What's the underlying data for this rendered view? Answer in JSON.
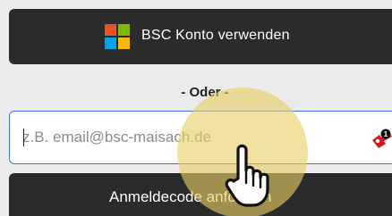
{
  "login": {
    "microsoft_button_label": "BSC Konto verwenden",
    "divider_text": "- Oder -",
    "email_placeholder": "z.B. email@bsc-maisach.de",
    "email_value": "",
    "password_manager_badge": "1",
    "code_button_label": "Anmeldecode anfordern"
  },
  "icons": {
    "microsoft_logo": "microsoft-logo-icon",
    "password_manager": "password-manager-key-icon",
    "cursor": "hand-pointer-cursor-icon"
  },
  "colors": {
    "dark_button": "#2b2b2b",
    "input_focus_border": "#3a6fd8",
    "page_background": "#ebebeb",
    "cursor_highlight": "#e8ce64",
    "password_manager_red": "#d0181d"
  }
}
